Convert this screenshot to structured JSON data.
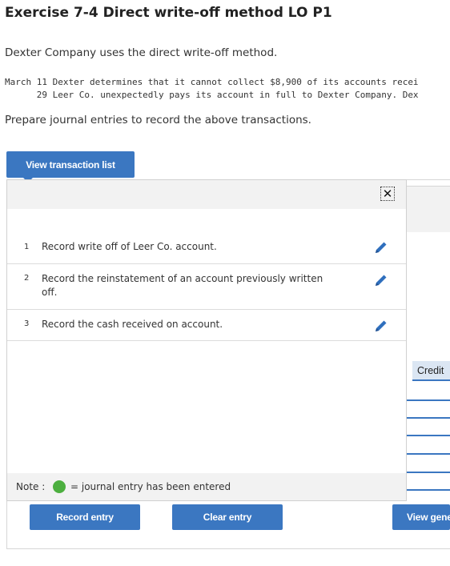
{
  "header": {
    "title": "Exercise 7-4 Direct write-off method LO P1"
  },
  "intro": "Dexter Company uses the direct write-off method.",
  "transactions": {
    "line1": "March 11 Dexter determines that it cannot collect $8,900 of its accounts recei",
    "line2": "      29 Leer Co. unexpectedly pays its account in full to Dexter Company. Dex"
  },
  "prompt": "Prepare journal entries to record the above transactions.",
  "buttons": {
    "view_transaction_list": "View transaction list",
    "record_entry": "Record entry",
    "clear_entry": "Clear entry",
    "view_general": "View gene"
  },
  "journal": {
    "credit_header": "Credit"
  },
  "popup": {
    "close_glyph": "✕",
    "items": [
      {
        "num": "1",
        "text": "Record write off of Leer Co. account."
      },
      {
        "num": "2",
        "text": "Record the reinstatement of an account previously written off."
      },
      {
        "num": "3",
        "text": "Record the cash received on account."
      }
    ],
    "note_label": "Note :",
    "note_text": "= journal entry has been entered"
  },
  "colors": {
    "accent": "#3b77c1",
    "entered_dot": "#4caf3f",
    "panel_gray": "#f2f2f2"
  },
  "icons": {
    "edit": "pencil-icon",
    "close": "close-icon"
  }
}
